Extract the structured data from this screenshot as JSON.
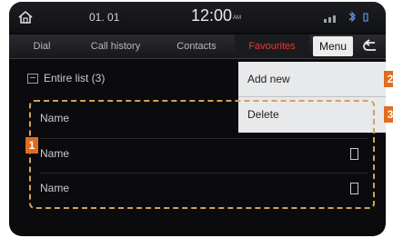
{
  "status": {
    "date": "01. 01",
    "time": "12:00",
    "ampm": "AM"
  },
  "tabs": {
    "dial": "Dial",
    "history": "Call history",
    "contacts": "Contacts",
    "favourites": "Favourites",
    "menu": "Menu"
  },
  "list": {
    "title": "Entire list (3)",
    "rows": [
      {
        "name": "Name"
      },
      {
        "name": "Name"
      },
      {
        "name": "Name"
      }
    ]
  },
  "menu_dropdown": {
    "add_new": "Add new",
    "delete": "Delete"
  },
  "callouts": [
    "1",
    "2",
    "3"
  ],
  "colors": {
    "active_tab": "#e63a2e",
    "callout": "#e06d1f",
    "dashed_frame": "#d4a15a"
  }
}
